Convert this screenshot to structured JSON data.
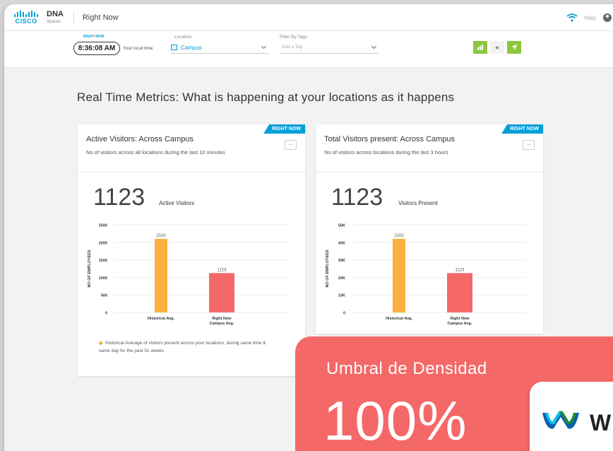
{
  "topbar": {
    "logo_text": "CISCO",
    "product": "DNA",
    "product_sub": "Spaces",
    "app_title": "Right Now",
    "help": "Help"
  },
  "filters": {
    "badge": "RIGHT NOW",
    "time": "8:36:08 AM",
    "time_label": "Your local time",
    "location_label": "Location",
    "location_value": "Campus",
    "tags_label": "Filter By Tags",
    "tags_placeholder": "Add a Tag"
  },
  "headline": "Real Time Metrics: What is happening at your locations as it happens",
  "cards": [
    {
      "ribbon": "RIGHT NOW",
      "title": "Active Visitors: Across Campus",
      "subtitle": "No of visitors across all locations during the last 10 minutes",
      "menu": "...",
      "big_value": "1123",
      "big_label": "Active Visitors",
      "footnote": "Historical Average of visitors present across your locations, during same time & same day for the past 51 weeks."
    },
    {
      "ribbon": "RIGHT NOW",
      "title": "Total Visitors present: Across Campus",
      "subtitle": "No of visitors across locations during the last 3 hours",
      "menu": "...",
      "big_value": "1123",
      "big_label": "Visitors Present"
    }
  ],
  "overlay": {
    "title": "Umbral de Densidad",
    "value": "100%",
    "brand_partial": "W"
  },
  "colors": {
    "accent": "#049fd9",
    "historical": "#fbb040",
    "right_now": "#f46867",
    "overlay": "#f46867"
  },
  "chart_data": [
    {
      "type": "bar",
      "categories": [
        "Historical Avg.",
        "Right Now Campus Avg."
      ],
      "category_lines": [
        [
          "Historical Avg."
        ],
        [
          "Right Now",
          "Campus Avg."
        ]
      ],
      "values": [
        2100,
        1123
      ],
      "data_labels": [
        "2100",
        "1123"
      ],
      "ylabel": "NO OF EMPLOYEES",
      "ylim": [
        0,
        2500
      ],
      "yticks": [
        0,
        500,
        1000,
        1500,
        2000,
        2500
      ],
      "ytick_labels": [
        "0",
        "500",
        "1000",
        "1500",
        "2000",
        "2500"
      ],
      "grid": true
    },
    {
      "type": "bar",
      "categories": [
        "Historical Avg.",
        "Right Now Campus Avg."
      ],
      "category_lines": [
        [
          "Historical Avg."
        ],
        [
          "Right Now",
          "Campus Avg."
        ]
      ],
      "values": [
        2100,
        1123
      ],
      "data_labels": [
        "2100",
        "1123"
      ],
      "ylabel": "NO OF EMPLOYEES",
      "ylim": [
        0,
        2500
      ],
      "yticks": [
        0,
        500,
        1000,
        1500,
        2000,
        2500
      ],
      "ytick_labels": [
        "0",
        "10K",
        "20K",
        "30K",
        "40K",
        "50K"
      ],
      "grid": true
    }
  ]
}
